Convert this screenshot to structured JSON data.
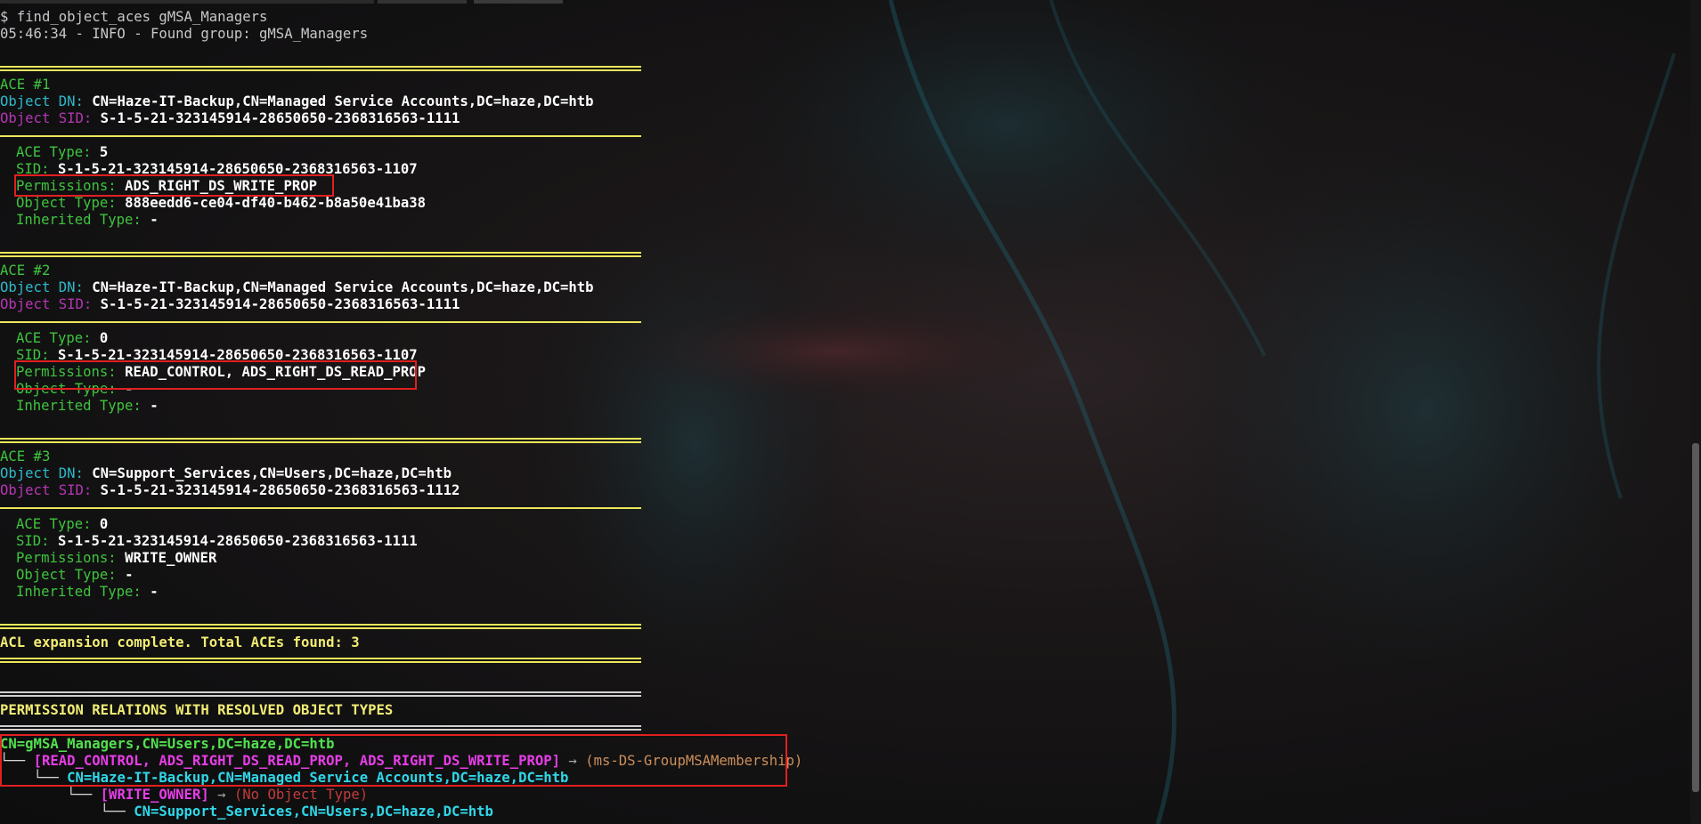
{
  "prompt": "$ find_object_aces gMSA_Managers",
  "info_line": "05:46:34 - INFO - Found group: gMSA_Managers",
  "aces": [
    {
      "title": "ACE #1",
      "object_dn_label": "Object DN:",
      "object_dn": "CN=Haze-IT-Backup,CN=Managed Service Accounts,DC=haze,DC=htb",
      "object_sid_label": "Object SID:",
      "object_sid": "S-1-5-21-323145914-28650650-2368316563-1111",
      "ace_type_label": "ACE Type:",
      "ace_type": "5",
      "sid_label": "SID:",
      "sid": "S-1-5-21-323145914-28650650-2368316563-1107",
      "permissions_label": "Permissions:",
      "permissions": "ADS_RIGHT_DS_WRITE_PROP",
      "object_type_label": "Object Type:",
      "object_type": "888eedd6-ce04-df40-b462-b8a50e41ba38",
      "inherited_type_label": "Inherited Type:",
      "inherited_type": "-"
    },
    {
      "title": "ACE #2",
      "object_dn_label": "Object DN:",
      "object_dn": "CN=Haze-IT-Backup,CN=Managed Service Accounts,DC=haze,DC=htb",
      "object_sid_label": "Object SID:",
      "object_sid": "S-1-5-21-323145914-28650650-2368316563-1111",
      "ace_type_label": "ACE Type:",
      "ace_type": "0",
      "sid_label": "SID:",
      "sid": "S-1-5-21-323145914-28650650-2368316563-1107",
      "permissions_label": "Permissions:",
      "permissions": "READ_CONTROL, ADS_RIGHT_DS_READ_PROP",
      "object_type_label": "Object Type:",
      "object_type": "-",
      "inherited_type_label": "Inherited Type:",
      "inherited_type": "-"
    },
    {
      "title": "ACE #3",
      "object_dn_label": "Object DN:",
      "object_dn": "CN=Support_Services,CN=Users,DC=haze,DC=htb",
      "object_sid_label": "Object SID:",
      "object_sid": "S-1-5-21-323145914-28650650-2368316563-1112",
      "ace_type_label": "ACE Type:",
      "ace_type": "0",
      "sid_label": "SID:",
      "sid": "S-1-5-21-323145914-28650650-2368316563-1111",
      "permissions_label": "Permissions:",
      "permissions": "WRITE_OWNER",
      "object_type_label": "Object Type:",
      "object_type": "-",
      "inherited_type_label": "Inherited Type:",
      "inherited_type": "-"
    }
  ],
  "summary": "ACL expansion complete. Total ACEs found: 3",
  "relations_header": "PERMISSION RELATIONS WITH RESOLVED OBJECT TYPES",
  "tree": {
    "root": "CN=gMSA_Managers,CN=Users,DC=haze,DC=htb",
    "branch1_prefix": "└── ",
    "branch1_perms": "[READ_CONTROL, ADS_RIGHT_DS_READ_PROP, ADS_RIGHT_DS_WRITE_PROP]",
    "arrow": " → ",
    "branch1_type": "(ms-DS-GroupMSAMembership)",
    "branch1_target_prefix": "    └── ",
    "branch1_target": "CN=Haze-IT-Backup,CN=Managed Service Accounts,DC=haze,DC=htb",
    "branch2_prefix": "        └── ",
    "branch2_perms": "[WRITE_OWNER]",
    "branch2_type": "(No Object Type)",
    "branch2_target_prefix": "            └── ",
    "branch2_target": "CN=Support_Services,CN=Users,DC=haze,DC=htb"
  },
  "colors": {
    "label_green": "#3ec43e",
    "label_cyan": "#2fb9c9",
    "label_magenta": "#b437b4",
    "separator_yellow": "#ece85a",
    "highlight_red": "#e12020"
  }
}
